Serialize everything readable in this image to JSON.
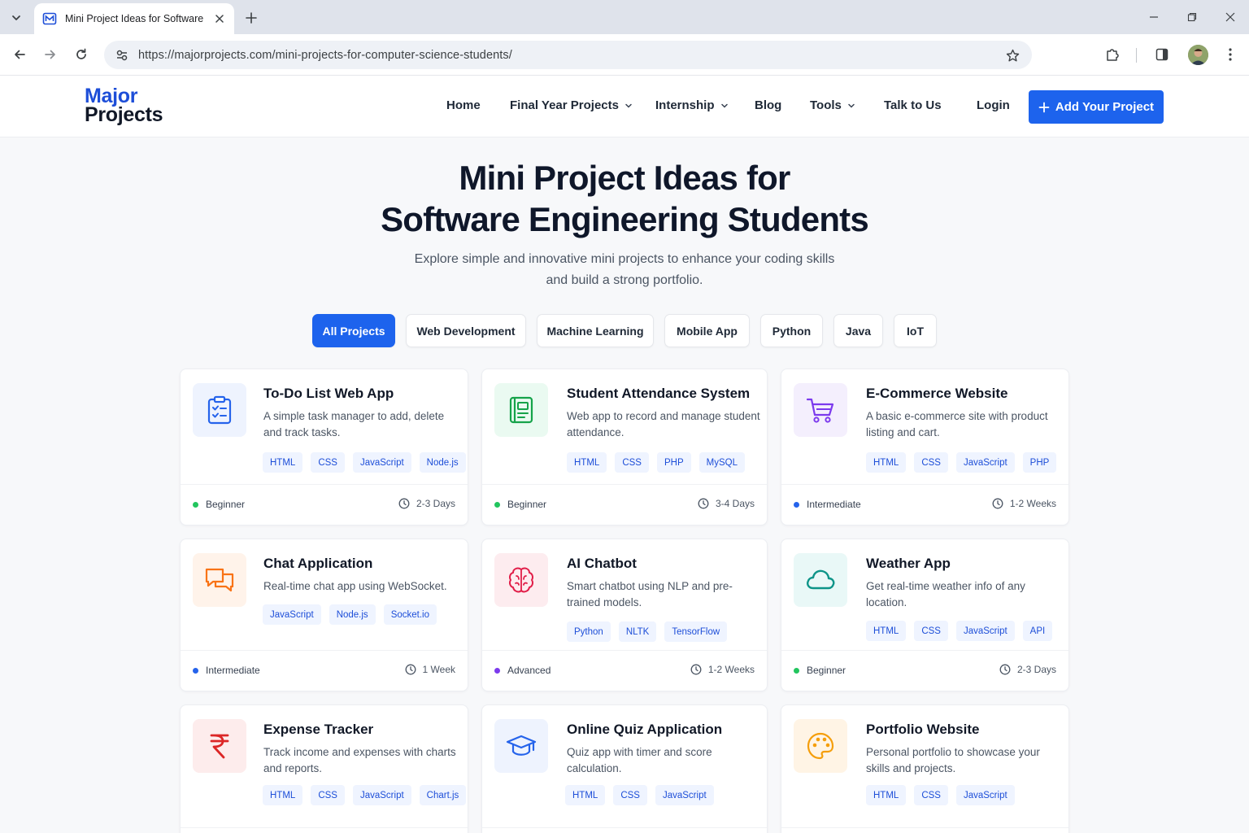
{
  "browser": {
    "tab_title": "Mini Project Ideas for Software E",
    "url_prefix": "https://majorprojects.com",
    "url_path": "/mini-projects-for-computer-science-students/"
  },
  "site": {
    "logo_line1": "Major",
    "logo_line2": "Projects",
    "nav": {
      "home": "Home",
      "final_year": "Final Year Projects",
      "internship": "Internship",
      "blog": "Blog",
      "tools": "Tools",
      "talk": "Talk to Us",
      "login": "Login"
    },
    "cta": "Add Your Project"
  },
  "hero": {
    "title_line1": "Mini Project Ideas for",
    "title_line2": "Software Engineering Students",
    "sub_line1": "Explore simple and innovative mini projects to enhance your coding skills",
    "sub_line2": "and build a strong portfolio."
  },
  "filters": [
    "All Projects",
    "Web Development",
    "Machine Learning",
    "Mobile App",
    "Python",
    "Java",
    "IoT"
  ],
  "colors": {
    "accent": "#1d63ed",
    "beginner": "#22c55e",
    "intermediate": "#2563eb",
    "advanced": "#7c3aed"
  },
  "projects": [
    {
      "title": "To-Do List Web App",
      "desc": "A simple task manager to add, delete and track tasks.",
      "tags": [
        "HTML",
        "CSS",
        "JavaScript",
        "Node.js"
      ],
      "level": "Beginner",
      "duration": "2-3 Days",
      "icon": "clipboard-check-icon"
    },
    {
      "title": "Student Attendance System",
      "desc": "Web app to record and manage student attendance.",
      "tags": [
        "HTML",
        "CSS",
        "PHP",
        "MySQL"
      ],
      "level": "Beginner",
      "duration": "3-4 Days",
      "icon": "book-icon"
    },
    {
      "title": "E-Commerce Website",
      "desc": "A basic e-commerce site with product listing and cart.",
      "tags": [
        "HTML",
        "CSS",
        "JavaScript",
        "PHP"
      ],
      "level": "Intermediate",
      "duration": "1-2 Weeks",
      "icon": "shopping-cart-icon"
    },
    {
      "title": "Chat Application",
      "desc": "Real-time chat app using WebSocket.",
      "tags": [
        "JavaScript",
        "Node.js",
        "Socket.io"
      ],
      "level": "Intermediate",
      "duration": "1 Week",
      "icon": "chat-bubbles-icon"
    },
    {
      "title": "AI Chatbot",
      "desc": "Smart chatbot using NLP and pre-trained models.",
      "tags": [
        "Python",
        "NLTK",
        "TensorFlow"
      ],
      "level": "Advanced",
      "duration": "1-2 Weeks",
      "icon": "brain-icon"
    },
    {
      "title": "Weather App",
      "desc": "Get real-time weather info of any location.",
      "tags": [
        "HTML",
        "CSS",
        "JavaScript",
        "API"
      ],
      "level": "Beginner",
      "duration": "2-3 Days",
      "icon": "cloud-icon"
    },
    {
      "title": "Expense Tracker",
      "desc": "Track income and expenses with charts and reports.",
      "tags": [
        "HTML",
        "CSS",
        "JavaScript",
        "Chart.js"
      ],
      "icon": "rupee-icon"
    },
    {
      "title": "Online Quiz Application",
      "desc": "Quiz app with timer and score calculation.",
      "tags": [
        "HTML",
        "CSS",
        "JavaScript"
      ],
      "icon": "graduation-cap-icon"
    },
    {
      "title": "Portfolio Website",
      "desc": "Personal portfolio to showcase your skills and projects.",
      "tags": [
        "HTML",
        "CSS",
        "JavaScript"
      ],
      "icon": "palette-icon"
    }
  ]
}
